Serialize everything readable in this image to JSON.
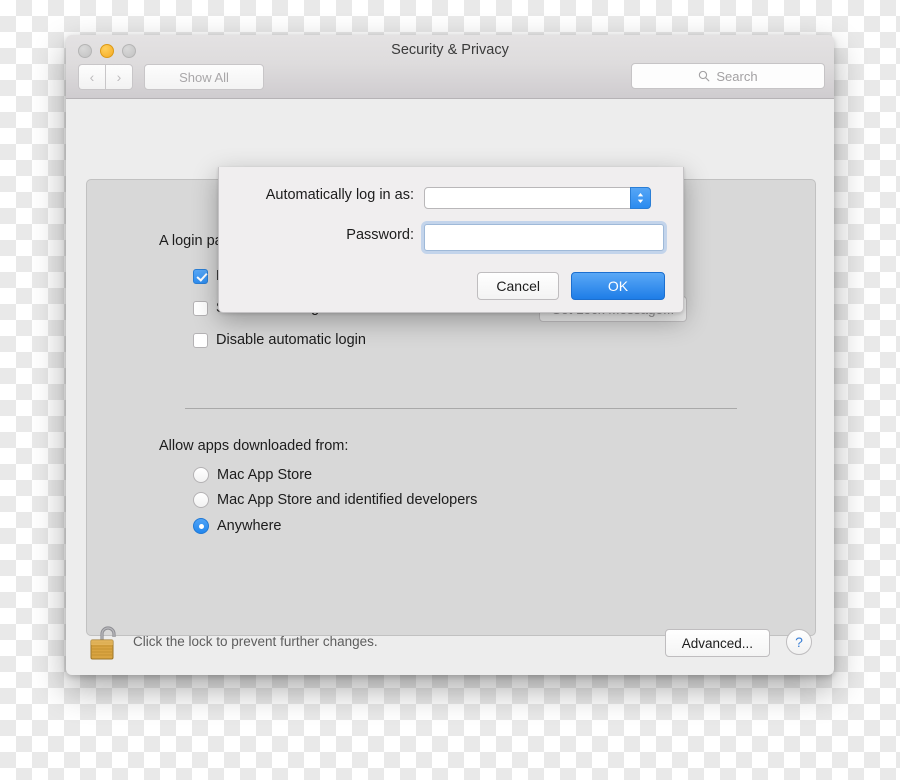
{
  "window": {
    "title": "Security & Privacy",
    "traffic_lights": [
      {
        "name": "close",
        "color": "#c8c8c8"
      },
      {
        "name": "minimize",
        "color": "#f5ab23"
      },
      {
        "name": "zoom",
        "color": "#c8c8c8"
      }
    ],
    "toolbar": {
      "back_glyph": "‹",
      "forward_glyph": "›",
      "show_all_label": "Show All"
    },
    "search": {
      "placeholder": "Search",
      "icon": "search-icon"
    }
  },
  "general_pane": {
    "lead_text": "A login password has been set for this user  Change Password...",
    "checkboxes": [
      {
        "label": "Require password  immediately  after sleep or screen saver begins",
        "checked": true
      },
      {
        "label": "Show a message when the screen is locked",
        "checked": false,
        "button_label": "Set Lock Message...",
        "button_enabled": false
      },
      {
        "label": "Disable automatic login",
        "checked": false
      }
    ],
    "allow_apps": {
      "title": "Allow apps downloaded from:",
      "options": [
        {
          "label": "Mac App Store",
          "selected": false
        },
        {
          "label": "Mac App Store and identified developers",
          "selected": false
        },
        {
          "label": "Anywhere",
          "selected": true
        }
      ]
    }
  },
  "bottom_bar": {
    "lock_icon": "unlocked-padlock-icon",
    "lock_text": "Click the lock to prevent further changes.",
    "advanced_label": "Advanced...",
    "help_label": "?"
  },
  "sheet": {
    "auto_login_label": "Automatically log in as:",
    "auto_login_value": "",
    "password_label": "Password:",
    "password_value": "",
    "cancel_label": "Cancel",
    "ok_label": "OK"
  },
  "colors": {
    "accent_blue": "#2b8bef",
    "ok_button_blue": "#1e7de7",
    "panel_gray": "#d8d8d8",
    "window_gray": "#ededed",
    "lock_gold": "#d9a441"
  }
}
